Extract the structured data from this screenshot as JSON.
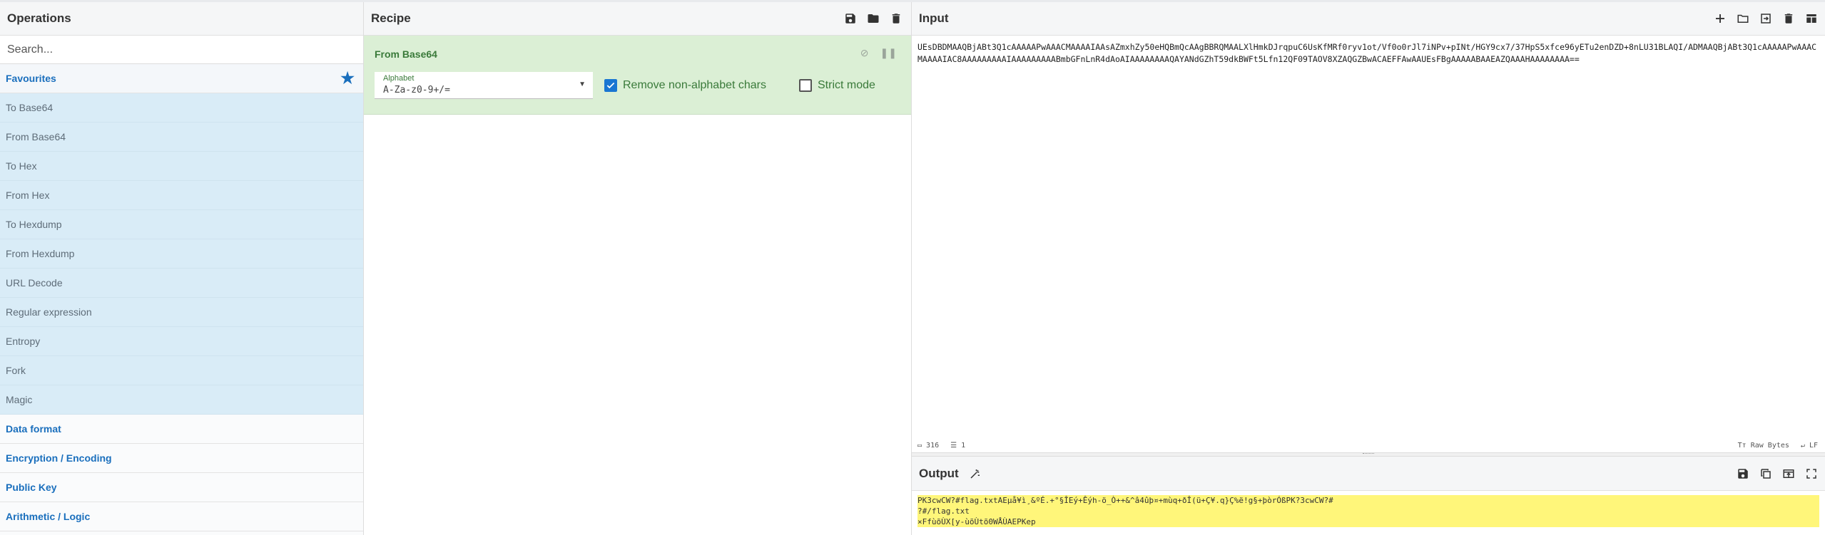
{
  "operations": {
    "title": "Operations",
    "search_placeholder": "Search...",
    "favourites": "Favourites",
    "favourite_items": [
      "To Base64",
      "From Base64",
      "To Hex",
      "From Hex",
      "To Hexdump",
      "From Hexdump",
      "URL Decode",
      "Regular expression",
      "Entropy",
      "Fork",
      "Magic"
    ],
    "categories": [
      "Data format",
      "Encryption / Encoding",
      "Public Key",
      "Arithmetic / Logic"
    ]
  },
  "recipe": {
    "title": "Recipe",
    "operation": {
      "name": "From Base64",
      "alphabet_label": "Alphabet",
      "alphabet_value": "A-Za-z0-9+/=",
      "remove_non_alphabet_label": "Remove non-alphabet chars",
      "remove_non_alphabet_checked": true,
      "strict_mode_label": "Strict mode",
      "strict_mode_checked": false
    }
  },
  "input": {
    "title": "Input",
    "text": "UEsDBDMAAQBjABt3Q1cAAAAAPwAAACMAAAAIAAsAZmxhZy50eHQBmQcAAgBBRQMAALXlHmkDJrqpuC6UsKfMRf0ryv1ot/Vf0o0rJl7iNPv+pINt/HGY9cx7/37HpS5xfce96yETu2enDZD+8nLU31BLAQI/ADMAAQBjABt3Q1cAAAAAPwAAACMAAAAIAC8AAAAAAAAAIAAAAAAAAABmbGFnLnR4dAoAIAAAAAAAAQAYANdGZhT59dkBWFt5Lfn12QF09TAOV8XZAQGZBwACAEFFAwAAUEsFBgAAAAABAAEAZQAAAHAAAAAAAA==",
    "char_count": "316",
    "line_count": "1",
    "encoding": "Raw Bytes",
    "eol": "LF"
  },
  "output": {
    "title": "Output",
    "text_line1": "PK\u0003\u00043\u0001c\u001bwCW?#flag.txt\u0007AE\u0003µå¥ì¸&ºÉ.+°§ÎEý+Êýh-ö_Ò++&^â4ûþ¤+mùq+ðÎ(ü+Ç¥.q}Ç%ë!g§+þòrÓßPK\u0001\u0002?3c\u001bwCW?#",
    "text_line2": "?#/flag.txt",
    "text_line3": "×Ff\u0014ùõÙ\u0001X[y-ùõÙ\u0001tõ0\u000eWÅÙ\u0001\u0007AE\u0003PK\u0005\u0006e\u0001p"
  },
  "colors": {
    "favourites_bg": "#d9ecf7",
    "recipe_op_bg": "#dbefd5",
    "accent": "#1a6fbd",
    "output_highlight": "#fff67a"
  }
}
